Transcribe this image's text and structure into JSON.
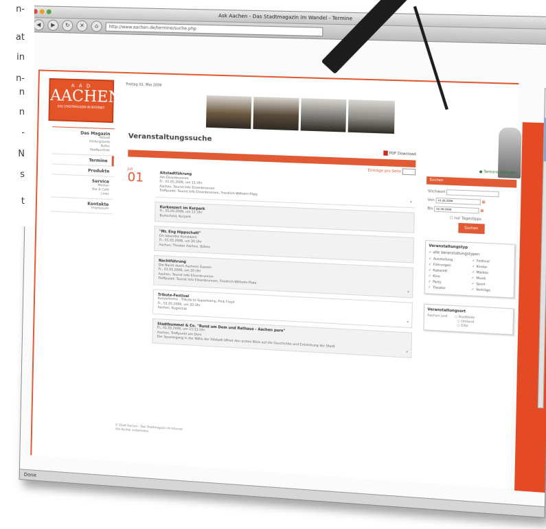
{
  "margin_text": [
    "n-",
    "at",
    "in",
    "n-",
    "n",
    "n",
    "-",
    "N",
    "s",
    "t"
  ],
  "browser": {
    "window_title": "Ask Aachen - Das Stadtmagazin im Wandel - Termine",
    "url": "http://www.aachen.de/termine/suche.php",
    "status": "Done"
  },
  "site": {
    "logo_top": "A A D",
    "logo_main": "AACHEN",
    "logo_sub": "DAS STADTMAGAZIN IM INTERNET",
    "date": "Freitag 01. Mai 2006"
  },
  "nav": [
    {
      "label": "Das Magazin",
      "sub": [
        "Aktuell",
        "Hintergründe",
        "Kultur",
        "Stadtportrait"
      ]
    },
    {
      "label": "Termine",
      "sub": []
    },
    {
      "label": "Produkte",
      "sub": []
    },
    {
      "label": "Service",
      "sub": [
        "Medien",
        "Bar & Café",
        "Links"
      ]
    },
    {
      "label": "Kontakte",
      "sub": [
        "Impressum"
      ]
    }
  ],
  "main": {
    "title": "Veranstaltungssuche",
    "pdf_label": "PDF Download",
    "per_page_label": "Einträge pro Seite",
    "month": "Juli",
    "day": "01",
    "events": [
      {
        "title": "Altstadtführung",
        "lines": [
          "Am Elisenbrunnen",
          "Fr., 01.05.2006, um 11 Uhr",
          "Aachen, Tourist Info Elisenbrunnen",
          "Treffpunkt: Tourist Info Elisenbrunnen, Friedrich-Wilhelm-Platz"
        ]
      },
      {
        "title": "Kurkonzert im Kurpark",
        "lines": [
          "Fr., 01.05.2006, um 11 Uhr",
          "Burtscheid, Kurpark"
        ]
      },
      {
        "title": "\"Mr. Eng Hippschutt\"",
        "lines": [
          "Ein lebendes Kunstwerk",
          "Fr., 01.05.2006, um 20 Uhr",
          "Aachen, Theater Aachen, Bühne"
        ]
      },
      {
        "title": "Nachtführung",
        "lines": [
          "Die Nacht durch Aachens Gassen",
          "Fr., 01.05.2006, um 20 Uhr",
          "Aachen, Tourist Info Elisenbrunnen",
          "Treffpunkt: Tourist Info Elisenbrunnen, Friedrich-Wilhelm-Platz"
        ]
      },
      {
        "title": "Tribute-Festival",
        "lines": [
          "Konzertreihe - Tribute to Supertramp, Pink Floyd",
          "Fr., 01.05.2006, um 20 Uhr",
          "Aachen, Kugelclub"
        ]
      },
      {
        "title": "Stadtbummel & Co. \"Rund um Dom und Rathaus - Aachen pure\"",
        "lines": [
          "Fr., 01.05.2006, um 15:15 Uhr",
          "Aachen, Treffpunkt am Dom",
          "Der Spaziergang in der Nähe der Altstadt öffnet den ersten Blick auf die Geschichte und Entstehung der Stadt."
        ]
      }
    ]
  },
  "sidebar": {
    "newsletter": "Termine abfragen",
    "search_title": "Suchen",
    "field_label": "Stichwort",
    "from_label": "Von",
    "to_label": "Bis",
    "from_value": "01.05.2006",
    "to_value": "01.05.2006",
    "check_label": "nur Tagestipps",
    "button": "Suchen",
    "categories_title": "Veranstaltungstyp",
    "all_label": "alle Veranstaltungstypen",
    "categories": [
      "Ausstellung",
      "Festival",
      "Führungen",
      "Kinder",
      "Kabarett",
      "Märkte",
      "Kino",
      "Musik",
      "Party",
      "Sport",
      "Theater",
      "Vorträge"
    ],
    "places_title": "Veranstaltungsort",
    "places_label": "Aachen und",
    "places": [
      "Stadtteile",
      "Umland",
      "Eifel"
    ]
  },
  "footer": [
    "© Stadt Aachen - Das Stadtmagazin im Internet",
    "Alle Rechte vorbehalten"
  ],
  "colors": {
    "accent": "#e05a33",
    "banner": [
      "#6b5840",
      "#5a4a38",
      "#7b7a76",
      "#8c8a84"
    ]
  }
}
